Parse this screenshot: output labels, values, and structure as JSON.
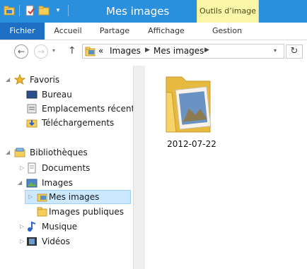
{
  "window": {
    "title": "Mes images",
    "contextual_tab": "Outils d’image"
  },
  "ribbon": {
    "tabs": [
      "Fichier",
      "Accueil",
      "Partage",
      "Affichage",
      "Gestion"
    ]
  },
  "address": {
    "prefix": "«",
    "crumbs": [
      "Images",
      "Mes images"
    ]
  },
  "nav": {
    "favorites_label": "Favoris",
    "favorites": [
      "Bureau",
      "Emplacements récents",
      "Téléchargements"
    ],
    "libraries_label": "Bibliothèques",
    "libraries": [
      "Documents",
      "Images",
      "Mes images",
      "Images publiques",
      "Musique",
      "Vidéos"
    ]
  },
  "content": {
    "items": [
      {
        "name": "2012-07-22",
        "icon": "image-folder-icon"
      }
    ]
  },
  "colors": {
    "titlebar": "#2a8fdd",
    "file_tab": "#1f6fc5",
    "contextual": "#fbf7a8",
    "selection": "#cce8ff"
  }
}
